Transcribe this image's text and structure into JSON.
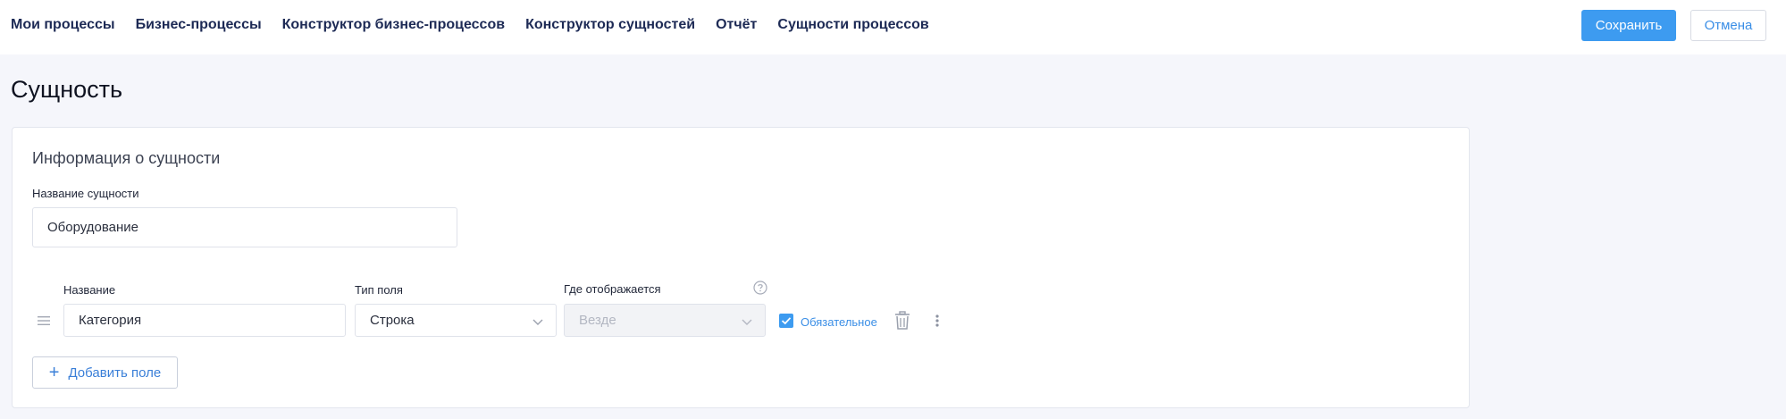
{
  "nav": {
    "items": [
      "Мои процессы",
      "Бизнес-процессы",
      "Конструктор бизнес-процессов",
      "Конструктор сущностей",
      "Отчёт",
      "Сущности процессов"
    ]
  },
  "header": {
    "save_label": "Сохранить",
    "cancel_label": "Отмена"
  },
  "page": {
    "title": "Сущность"
  },
  "card": {
    "title": "Информация о сущности",
    "entity_name_label": "Название сущности",
    "entity_name_value": "Оборудование"
  },
  "fields": {
    "headers": {
      "name": "Название",
      "type": "Тип поля",
      "where": "Где отображается"
    },
    "rows": [
      {
        "name": "Категория",
        "type": "Строка",
        "where": "Везде",
        "required_label": "Обязательное",
        "required": true
      }
    ]
  },
  "actions": {
    "add_field_label": "Добавить поле"
  },
  "colors": {
    "accent": "#3d9bf0",
    "nav_text": "#1d2a55",
    "background": "#f5f6fb"
  },
  "icons": [
    "drag-handle-icon",
    "help-icon",
    "chevron-down-icon",
    "check-icon",
    "trash-icon",
    "more-vertical-icon",
    "plus-icon"
  ]
}
